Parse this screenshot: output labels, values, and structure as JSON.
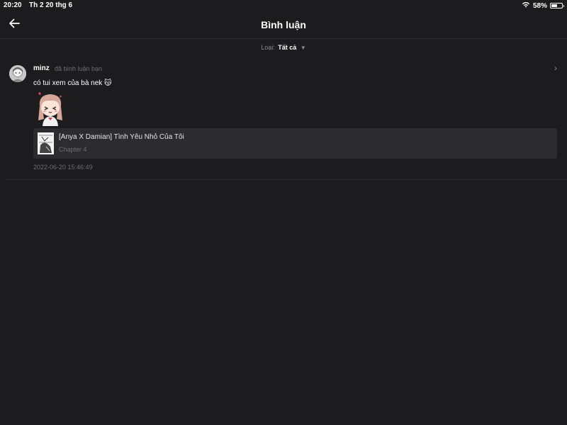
{
  "status_bar": {
    "time": "20:20",
    "date": "Th 2 20 thg 6",
    "battery_percent": "58%",
    "battery_level": 0.58,
    "wifi_icon": "wifi-icon",
    "battery_icon": "battery-icon"
  },
  "nav": {
    "title": "Bình luận",
    "back_icon": "arrow-left-icon"
  },
  "filter": {
    "label": "Loại:",
    "value": "Tất cả",
    "caret_icon": "caret-down-icon"
  },
  "comment": {
    "username": "minz",
    "action": "đã bình luận bạn",
    "text": "có tui xem của bà nek 😽",
    "timestamp": "2022-06-20 15:46:49",
    "manga": {
      "title": "[Anya X Damian] Tình Yêu Nhỏ Của Tôi",
      "chapter": "Chapter 4"
    }
  },
  "colors": {
    "background": "#1c1c1e",
    "card": "#2c2c2e",
    "muted_text": "#6e6e73"
  }
}
